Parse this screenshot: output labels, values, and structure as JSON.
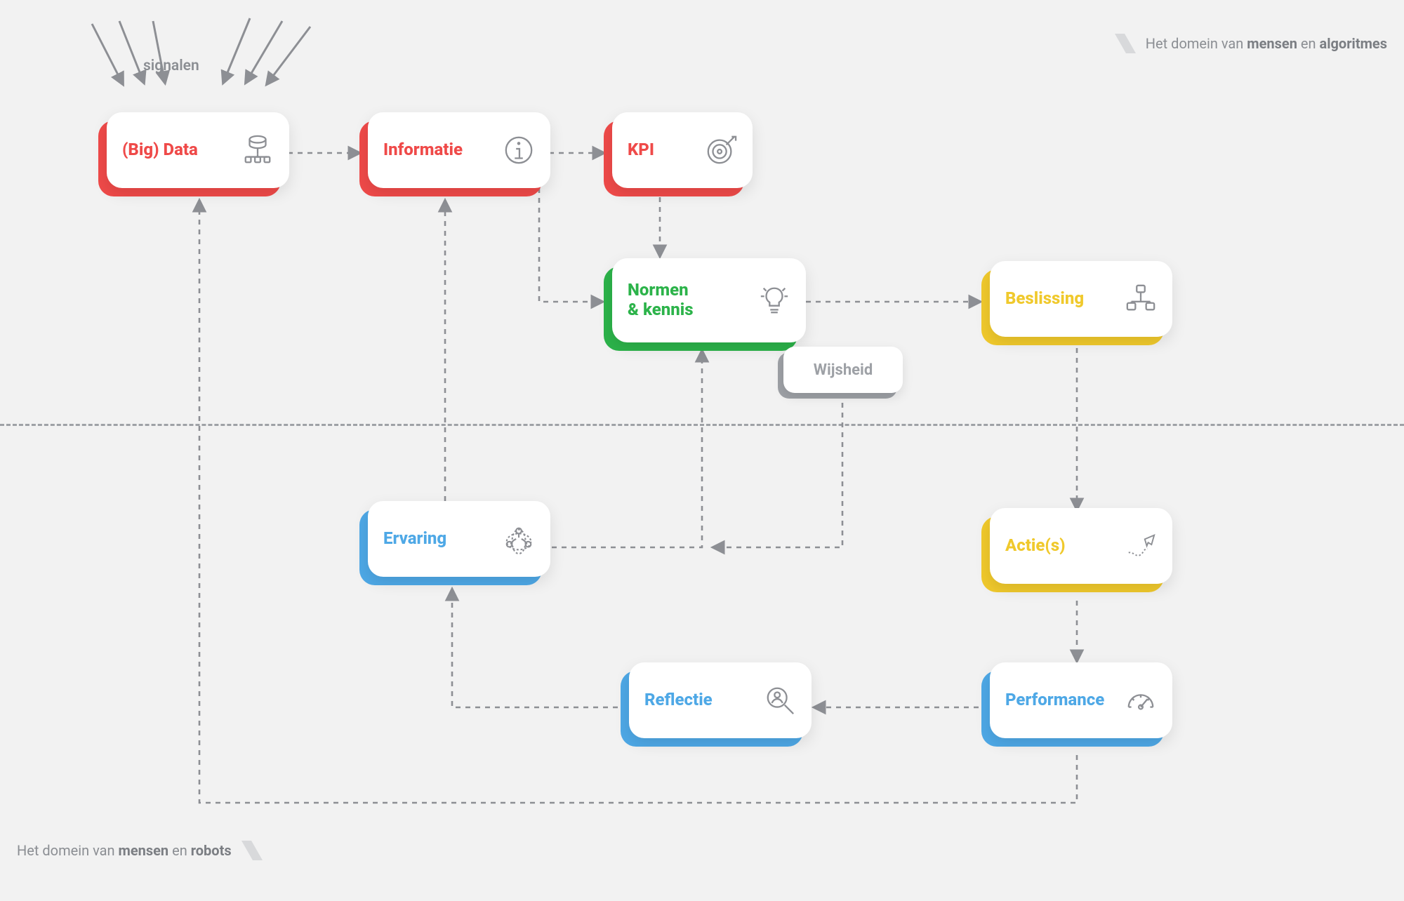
{
  "colors": {
    "red": "#ef4a49",
    "green": "#2cb34a",
    "yellow": "#f0c92c",
    "blue": "#4ea8e6",
    "gray": "#9ea1a6",
    "connector": "#8d8f94"
  },
  "signals": {
    "label": "signalen"
  },
  "domain_top": {
    "prefix": "Het domein van ",
    "bold1": "mensen",
    "mid": " en ",
    "bold2": "algoritmes"
  },
  "domain_bottom": {
    "prefix": "Het domein van ",
    "bold1": "mensen",
    "mid": " en ",
    "bold2": "robots"
  },
  "nodes": {
    "big_data": {
      "label": "(Big) Data",
      "color": "red",
      "icon": "database-tree"
    },
    "informatie": {
      "label": "Informatie",
      "color": "red",
      "icon": "info"
    },
    "kpi": {
      "label": "KPI",
      "color": "red",
      "icon": "target"
    },
    "normen": {
      "label": "Normen\n& kennis",
      "color": "green",
      "icon": "lightbulb"
    },
    "wijsheid": {
      "label": "Wijsheid",
      "color": "gray"
    },
    "beslissing": {
      "label": "Beslissing",
      "color": "yellow",
      "icon": "decision-tree"
    },
    "acties": {
      "label": "Actie(s)",
      "color": "yellow",
      "icon": "paper-plane-path"
    },
    "performance": {
      "label": "Performance",
      "color": "blue",
      "icon": "gauge"
    },
    "reflectie": {
      "label": "Reflectie",
      "color": "blue",
      "icon": "magnify-person"
    },
    "ervaring": {
      "label": "Ervaring",
      "color": "blue",
      "icon": "community-brain"
    }
  },
  "connectors": [
    {
      "from": "big_data",
      "to": "informatie",
      "style": "dashed-arrow"
    },
    {
      "from": "informatie",
      "to": "kpi",
      "style": "dashed-arrow"
    },
    {
      "from": "informatie",
      "to": "normen",
      "style": "dashed-arrow-elbow"
    },
    {
      "from": "kpi",
      "to": "normen",
      "style": "dashed-arrow"
    },
    {
      "from": "normen",
      "to": "beslissing",
      "style": "dashed-arrow"
    },
    {
      "from": "beslissing",
      "to": "acties",
      "style": "dashed-arrow"
    },
    {
      "from": "acties",
      "to": "performance",
      "style": "dashed-arrow"
    },
    {
      "from": "performance",
      "to": "reflectie",
      "style": "dashed-arrow"
    },
    {
      "from": "reflectie",
      "to": "ervaring",
      "style": "dashed-arrow-elbow"
    },
    {
      "from": "performance",
      "to": "big_data",
      "style": "dashed-arrow-long-loop"
    },
    {
      "from": "ervaring",
      "to": "normen",
      "style": "dashed-arrow-elbow"
    },
    {
      "from": "ervaring",
      "to": "informatie",
      "style": "dashed-arrow-loop"
    },
    {
      "from": "wijsheid",
      "to": "normen",
      "style": "dashed-arrow-elbow"
    }
  ]
}
